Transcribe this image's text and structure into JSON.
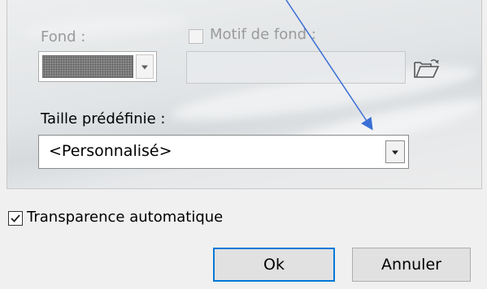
{
  "background_section": {
    "fond_label": "Fond :",
    "motif_label": "Motif de fond :",
    "motif_checked": false,
    "preset_label": "Taille prédéfinie :",
    "preset_value": "<Personnalisé>"
  },
  "options": {
    "auto_transparency_label": "Transparence automatique",
    "auto_transparency_checked": true
  },
  "buttons": {
    "ok_label": "Ok",
    "cancel_label": "Annuler"
  },
  "colors": {
    "accent": "#0078d7",
    "annotation_arrow": "#3b6fd6"
  },
  "icons": {
    "folder": "open-folder-icon",
    "dropdown": "chevron-down-icon",
    "check": "checkmark-icon"
  }
}
